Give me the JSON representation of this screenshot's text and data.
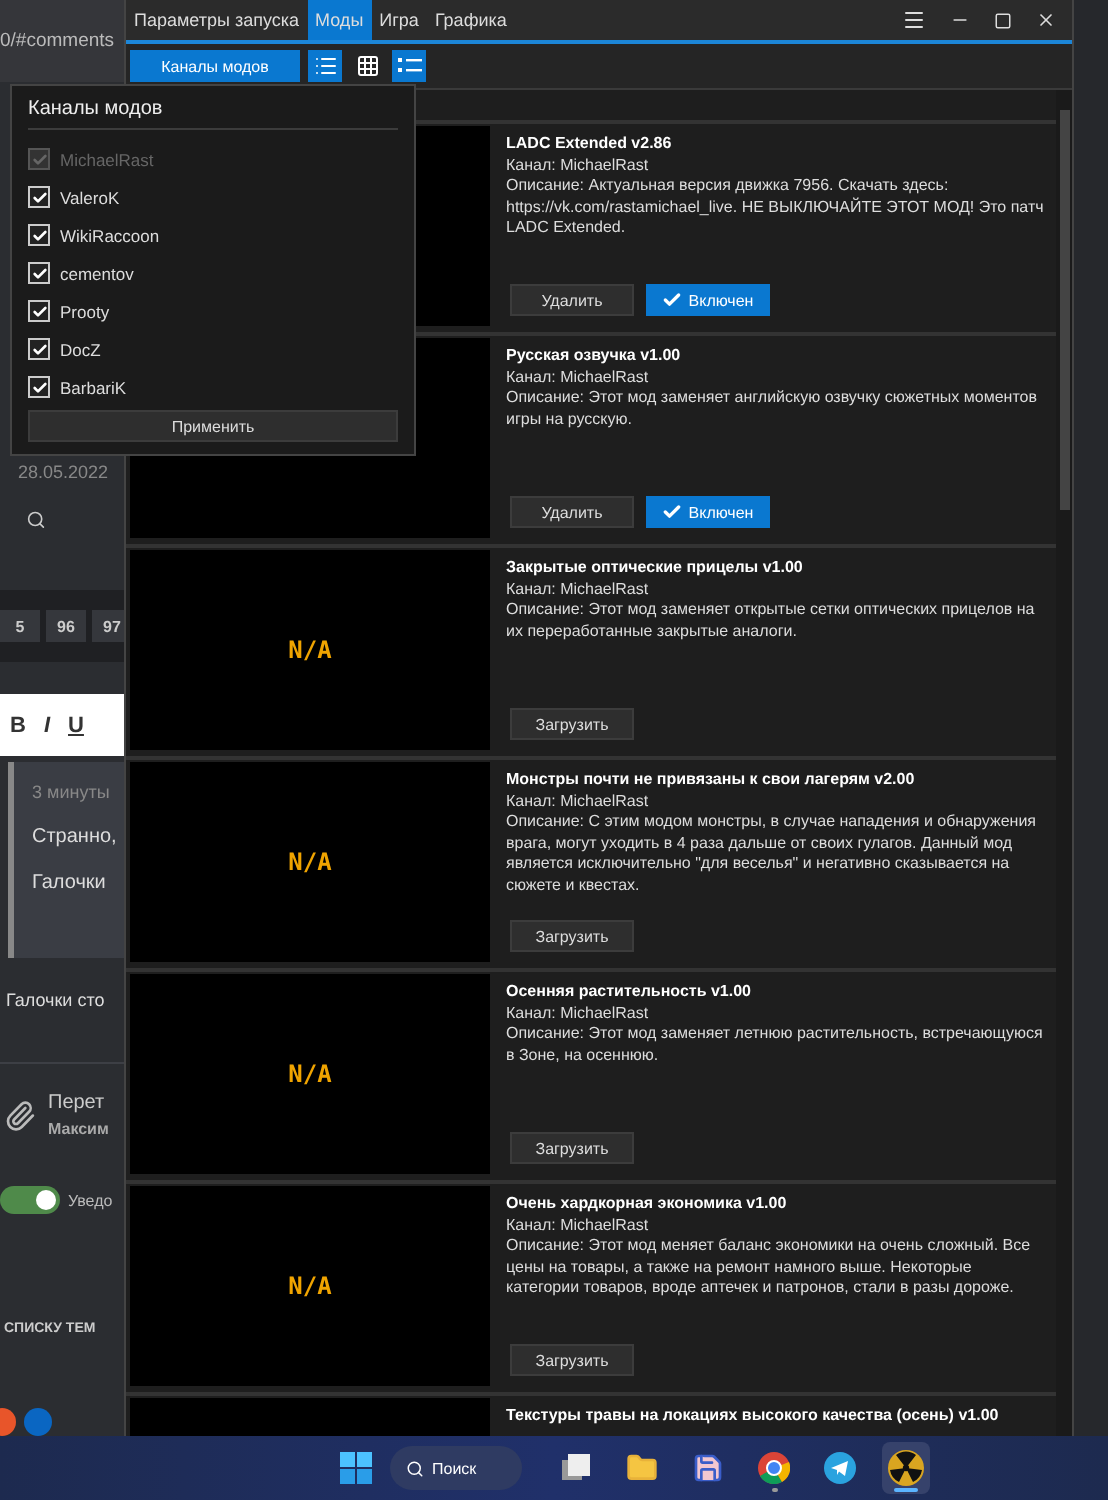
{
  "app": {
    "tabs": [
      {
        "label": "Параметры запуска",
        "selected": false
      },
      {
        "label": "Моды",
        "selected": true
      },
      {
        "label": "Игра",
        "selected": false
      },
      {
        "label": "Графика",
        "selected": false
      }
    ],
    "channels_button": "Каналы модов",
    "view_toggles": [
      {
        "kind": "list",
        "on": true
      },
      {
        "kind": "grid",
        "on": false
      },
      {
        "kind": "compact",
        "on": true
      }
    ]
  },
  "mods": [
    {
      "kind": "installed",
      "title": "LADC Extended v2.86",
      "channel": "Канал: MichaelRast",
      "description": "Описание: Актуальная версия движка 7956. Скачать здесь: https://vk.com/rastamichael_live. НЕ ВЫКЛЮЧАЙТЕ ЭТОТ МОД! Это патч LADC Extended.",
      "delete_label": "Удалить",
      "toggle_label": "Включен",
      "enabled": true
    },
    {
      "kind": "installed",
      "title": "Русская озвучка v1.00",
      "channel": "Канал: MichaelRast",
      "description": "Описание: Этот мод заменяет английскую озвучку сюжетных моментов игры на русскую.",
      "delete_label": "Удалить",
      "toggle_label": "Включен",
      "enabled": true
    },
    {
      "kind": "available",
      "preview": "N/A",
      "title": "Закрытые оптические прицелы v1.00",
      "channel": "Канал: MichaelRast",
      "description": "Описание: Этот мод заменяет открытые сетки оптических прицелов на их переработанные закрытые аналоги.",
      "action_label": "Загрузить"
    },
    {
      "kind": "available",
      "preview": "N/A",
      "title": "Монстры почти не привязаны к свои лагерям v2.00",
      "channel": "Канал: MichaelRast",
      "description": "Описание: С этим модом монстры, в случае нападения и обнаружения врага, могут уходить в 4 раза дальше от своих гулагов. Данный мод является исключительно \"для веселья\" и негативно сказывается на сюжете и квестах.",
      "action_label": "Загрузить"
    },
    {
      "kind": "available",
      "preview": "N/A",
      "title": "Осенняя растительность v1.00",
      "channel": "Канал: MichaelRast",
      "description": "Описание: Этот мод заменяет летнюю растительность, встречающуюся в Зоне, на осеннюю.",
      "action_label": "Загрузить"
    },
    {
      "kind": "available",
      "preview": "N/A",
      "title": "Очень хардкорная экономика v1.00",
      "channel": "Канал: MichaelRast",
      "description": "Описание: Этот мод меняет баланс экономики на очень сложный. Все цены на товары, а также на ремонт намного выше. Некоторые категории товаров, вроде аптечек и патронов, стали в разы дороже.",
      "action_label": "Загрузить"
    },
    {
      "kind": "cut",
      "title": "Текстуры травы на локациях высокого качества (осень) v1.00"
    }
  ],
  "channels_popup": {
    "title": "Каналы модов",
    "apply_label": "Применить",
    "channels": [
      {
        "name": "MichaelRast",
        "checked": true,
        "disabled": true
      },
      {
        "name": "ValeroK",
        "checked": true,
        "disabled": false
      },
      {
        "name": "WikiRaccoon",
        "checked": true,
        "disabled": false
      },
      {
        "name": "cementov",
        "checked": true,
        "disabled": false
      },
      {
        "name": "Prooty",
        "checked": true,
        "disabled": false
      },
      {
        "name": "DocZ",
        "checked": true,
        "disabled": false
      },
      {
        "name": "BarbariK",
        "checked": true,
        "disabled": false
      }
    ]
  },
  "background_page": {
    "address": "0/#comments",
    "date": "28.05.2022",
    "pages": [
      "5",
      "96",
      "97"
    ],
    "editor_buttons": [
      "B",
      "I",
      "U"
    ],
    "quote": {
      "time": "3 минуты",
      "lines": [
        "Странно,",
        "Галочки"
      ]
    },
    "comment": "Галочки сто",
    "attachment": {
      "title": "Перет",
      "author": "Максим"
    },
    "notify": {
      "label": "Уведо",
      "on": true
    },
    "back_link": "СПИСКУ ТЕМ"
  },
  "taskbar": {
    "search": "Поиск",
    "apps": [
      {
        "kind": "task-view",
        "running": false,
        "active": false
      },
      {
        "kind": "folder",
        "running": false,
        "active": false
      },
      {
        "kind": "floppy",
        "running": false,
        "active": false
      },
      {
        "kind": "browser",
        "running": true,
        "active": false
      },
      {
        "kind": "messenger",
        "running": false,
        "active": false
      },
      {
        "kind": "radiation",
        "running": true,
        "active": true
      }
    ]
  }
}
